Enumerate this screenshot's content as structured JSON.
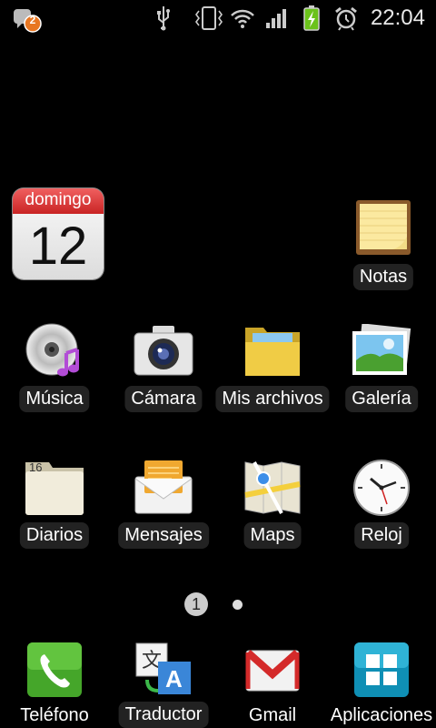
{
  "status_bar": {
    "notification_count": "2",
    "time": "22:04",
    "icons": [
      "notification-badge-icon",
      "usb-icon",
      "vibrate-icon",
      "wifi-icon",
      "signal-icon",
      "battery-charging-icon",
      "alarm-icon"
    ]
  },
  "calendar_widget": {
    "day_name": "domingo",
    "day_number": "12",
    "header_color": "#e23b3b"
  },
  "apps": {
    "notas": "Notas",
    "musica": "Música",
    "camara": "Cámara",
    "mis_archivos": "Mis archivos",
    "galeria": "Galería",
    "diarios": "Diarios",
    "diarios_date": "16",
    "mensajes": "Mensajes",
    "maps": "Maps",
    "reloj": "Reloj"
  },
  "pager": {
    "current_page": "1",
    "total_pages": 2
  },
  "dock": {
    "telefono": "Teléfono",
    "traductor": "Traductor",
    "gmail": "Gmail",
    "aplicaciones": "Aplicaciones"
  }
}
